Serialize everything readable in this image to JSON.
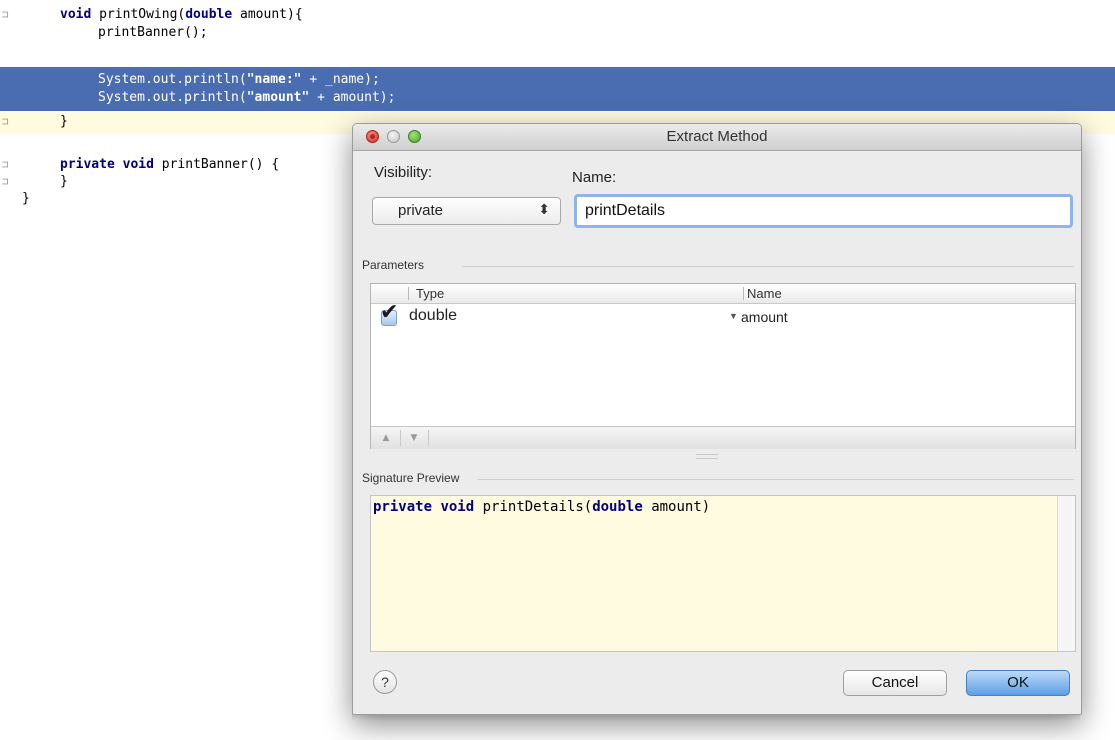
{
  "editor": {
    "line1": {
      "kw1": "void",
      "name": "printOwing(",
      "kw2": "double",
      "rest": "amount){"
    },
    "line2": {
      "text": "printBanner();"
    },
    "line3": {
      "pre": "System.out.println(",
      "str": "\"name:\"",
      "post": " + _name);"
    },
    "line4": {
      "pre": "System.out.println(",
      "str": "\"amount\"",
      "post": " + amount);"
    },
    "line5": {
      "text": "}"
    },
    "line6": {
      "kw1": "private",
      "kw2": "void",
      "rest": "printBanner() {"
    },
    "line7": {
      "text": "}"
    },
    "line8": {
      "text": "}"
    },
    "gutter": {
      "g1": "⊐",
      "g5": "⊐",
      "g6": "⊐",
      "g7": "⊐"
    }
  },
  "dialog": {
    "title": "Extract Method",
    "visibility_label": "Visibility:",
    "visibility_value": "private",
    "visibility_arrow": "⬍",
    "name_label": "Name:",
    "name_value": "printDetails",
    "parameters_label": "Parameters",
    "columns": {
      "type": "Type",
      "name": "Name"
    },
    "rows": [
      {
        "checked": true,
        "type": "double",
        "name": "amount"
      }
    ],
    "move_up": "▲",
    "move_down": "▼",
    "signature_label": "Signature Preview",
    "signature": {
      "kw1": "private",
      "kw2": "void",
      "method": "printDetails(",
      "kw3": "double",
      "rest": "amount)"
    },
    "help_label": "?",
    "cancel_label": "Cancel",
    "ok_label": "OK"
  },
  "colors": {
    "selection": "#4a6db2",
    "keyword": "#000080",
    "preview_bg": "#fffbe0",
    "ok_button": "#5d9ee6"
  }
}
